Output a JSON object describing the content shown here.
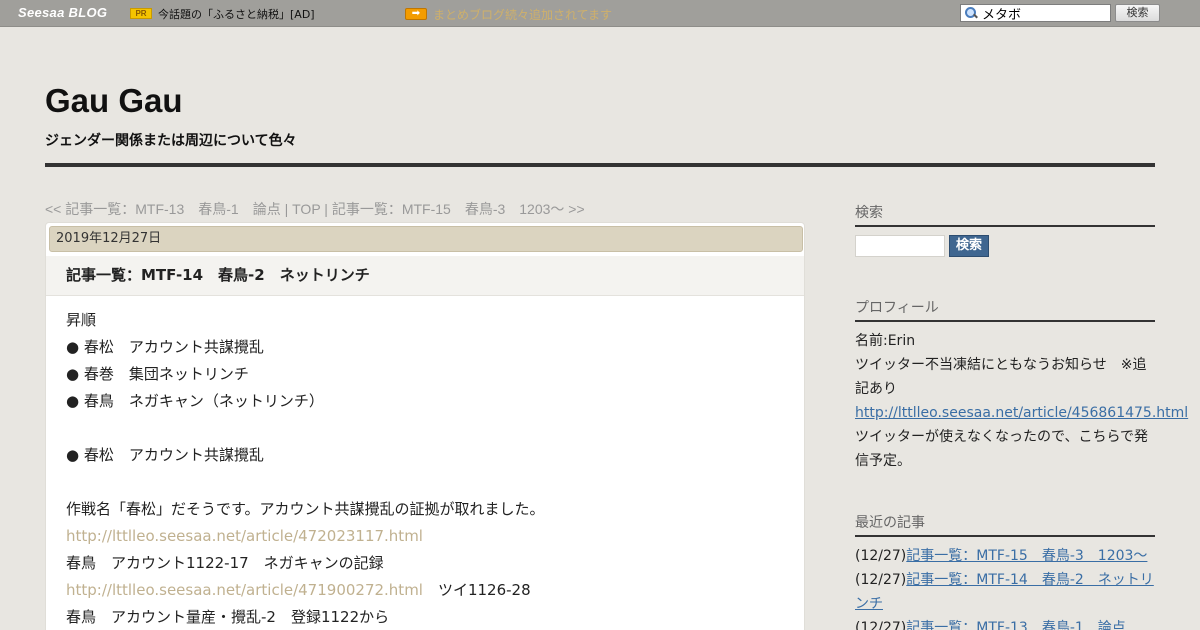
{
  "topbar": {
    "brand": "Seesaa BLOG",
    "pr_badge": "PR",
    "pr_text": "今話題の「ふるさと納税」[AD]",
    "arrow_icon": "arrow-right-icon",
    "notice": "まとめブログ続々追加されてます",
    "search_value": "メタボ",
    "search_button": "検索"
  },
  "header": {
    "title": "Gau Gau",
    "description": "ジェンダー関係または周辺について色々"
  },
  "article_nav": {
    "prev": "<< 記事一覧：MTF-13　春鳥-1　論点",
    "sep1": " | ",
    "top": "TOP",
    "sep2": " | ",
    "next": "記事一覧：MTF-15　春鳥-3　1203～ >>"
  },
  "article": {
    "date": "2019年12月27日",
    "title": "記事一覧：MTF-14　春鳥-2　ネットリンチ",
    "body": {
      "l1": "昇順",
      "l2": "● 春松　アカウント共謀攪乱",
      "l3": "● 春巻　集団ネットリンチ",
      "l4": "● 春鳥　ネガキャン（ネットリンチ）",
      "l5": "● 春松　アカウント共謀攪乱",
      "l6": "作戦名「春松」だそうです。アカウント共謀攪乱の証拠が取れました。",
      "l7_link": "http://lttlleo.seesaa.net/article/472023117.html",
      "l8": "春鳥　アカウント1122-17　ネガキャンの記録",
      "l9_link": "http://lttlleo.seesaa.net/article/471900272.html",
      "l9_text": "　ツイ1126-28",
      "l10": "春鳥　アカウント量産・攪乱-2　登録1122から"
    }
  },
  "sidebar": {
    "search_heading": "検索",
    "search_button": "検索",
    "profile_heading": "プロフィール",
    "profile_name": "名前:Erin",
    "profile_notice": "ツイッター不当凍結にともなうお知らせ　※追記あり",
    "profile_link": "http://lttlleo.seesaa.net/article/456861475.html",
    "profile_text": "ツイッターが使えなくなったので、こちらで発信予定。",
    "recent_heading": "最近の記事",
    "recent": [
      {
        "date": "(12/27)",
        "title": "記事一覧：MTF-15　春鳥-3　1203～"
      },
      {
        "date": "(12/27)",
        "title": "記事一覧：MTF-14　春鳥-2　ネットリンチ"
      },
      {
        "date": "(12/27)",
        "title": "記事一覧：MTF-13　春鳥-1　論点"
      }
    ]
  }
}
